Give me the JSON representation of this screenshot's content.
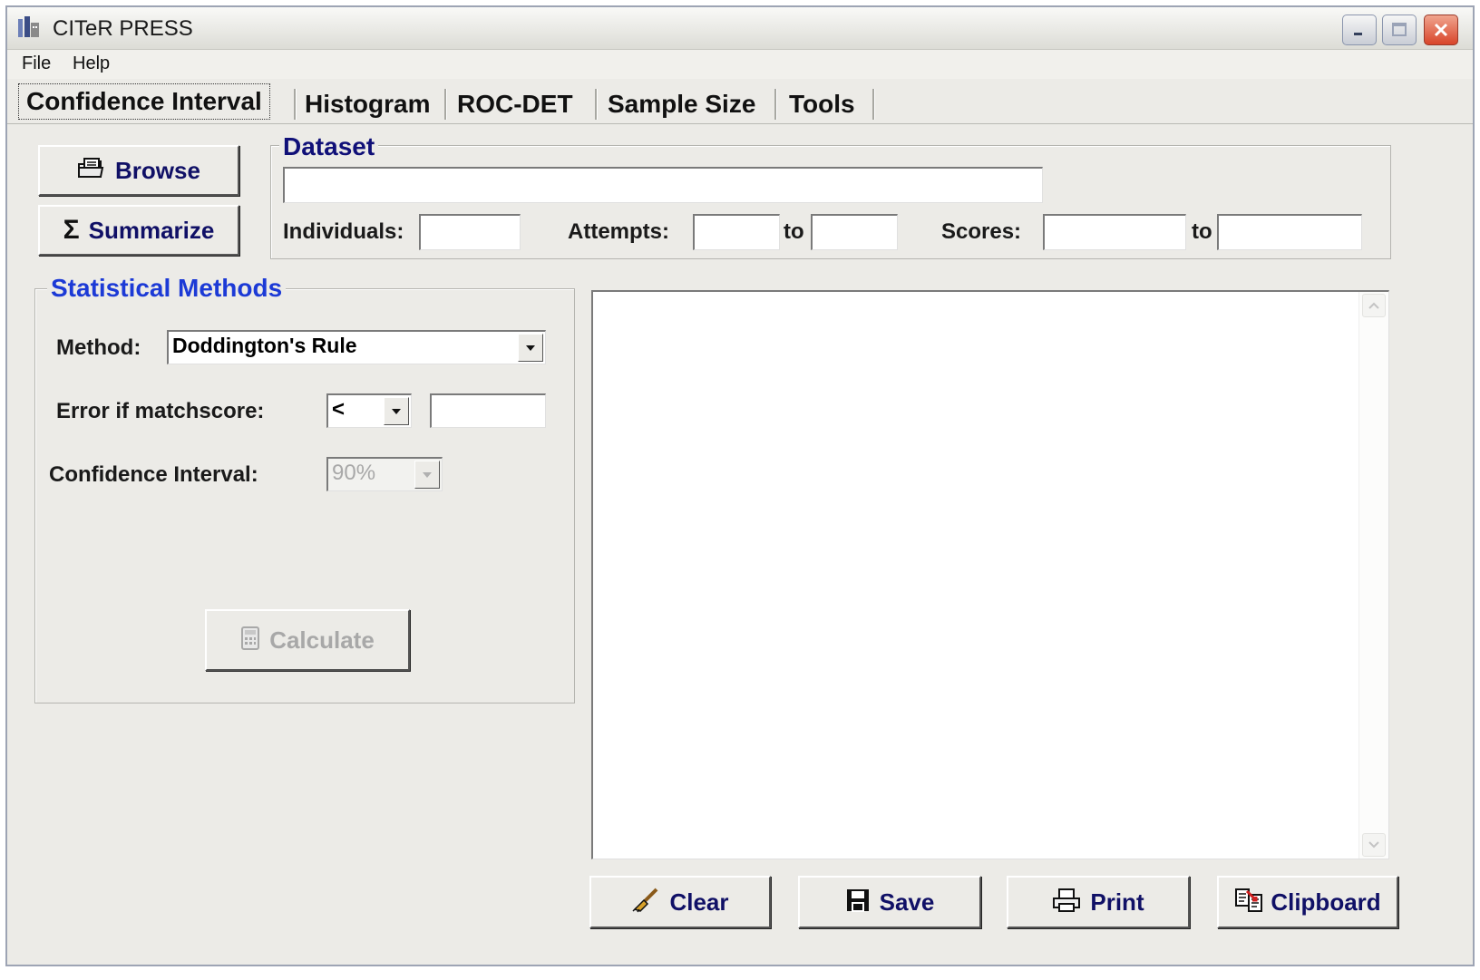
{
  "window": {
    "title": "CITeR PRESS"
  },
  "menu": {
    "items": [
      "File",
      "Help"
    ]
  },
  "tabs": [
    {
      "label": "Confidence Interval",
      "active": true
    },
    {
      "label": "Histogram",
      "active": false
    },
    {
      "label": "ROC-DET",
      "active": false
    },
    {
      "label": "Sample Size",
      "active": false
    },
    {
      "label": "Tools",
      "active": false
    }
  ],
  "buttons": {
    "browse": "Browse",
    "summarize": "Summarize",
    "calculate": "Calculate",
    "clear": "Clear",
    "save": "Save",
    "print": "Print",
    "clipboard": "Clipboard"
  },
  "icons": {
    "browse": "folder-document-icon",
    "summarize": "sigma-icon",
    "calculate": "calculator-icon",
    "clear": "broom-icon",
    "save": "floppy-disk-icon",
    "print": "printer-icon",
    "clipboard": "clipboard-copy-icon"
  },
  "dataset": {
    "legend": "Dataset",
    "path_value": "",
    "individuals_label": "Individuals:",
    "individuals_value": "",
    "attempts_label": "Attempts:",
    "attempts_from": "",
    "attempts_to_label": "to",
    "attempts_to": "",
    "scores_label": "Scores:",
    "scores_from": "",
    "scores_to_label": "to",
    "scores_to": ""
  },
  "methods": {
    "legend": "Statistical Methods",
    "method_label": "Method:",
    "method_value": "Doddington's Rule",
    "error_label": "Error if matchscore:",
    "operator_value": "<",
    "threshold_value": "",
    "ci_label": "Confidence Interval:",
    "ci_value": "90%",
    "ci_enabled": false,
    "calculate_enabled": false
  },
  "output": {
    "text": ""
  },
  "colors": {
    "legend_dataset": "#101078",
    "legend_methods": "#1c3ad6",
    "button_text": "#101066",
    "window_bg": "#ecebe7"
  }
}
